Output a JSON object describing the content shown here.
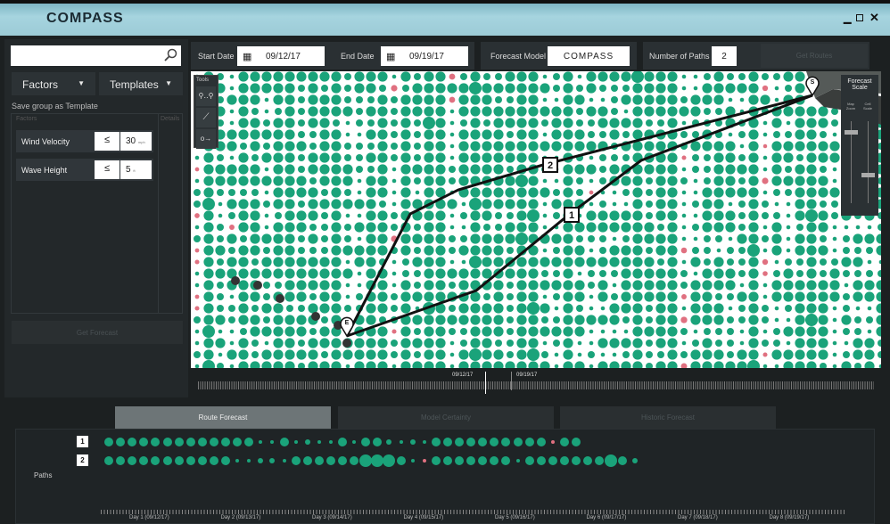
{
  "app": {
    "title": "COMPASS",
    "window_controls": [
      "minimize",
      "maximize",
      "close"
    ]
  },
  "sidebar": {
    "search_value": "",
    "factors_label": "Factors",
    "templates_label": "Templates",
    "save_template": "Save group as Template",
    "col_factors": "Factors",
    "col_details": "Details",
    "factors": [
      {
        "name": "Wind Velocity",
        "op": "≤",
        "value": "30",
        "unit": "mph"
      },
      {
        "name": "Wave Height",
        "op": "≤",
        "value": "5",
        "unit": "ft"
      }
    ],
    "get_forecast": "Get Forecast"
  },
  "toolbar": {
    "start_label": "Start Date",
    "start_value": "09/12/17",
    "end_label": "End Date",
    "end_value": "09/19/17",
    "model_label": "Forecast Model",
    "model_value": "COMPASS",
    "paths_label": "Number of Paths",
    "paths_value": "2",
    "get_routes": "Get Routes"
  },
  "map": {
    "tools_label": "Tools",
    "tools": [
      "waypoints-tool",
      "line-tool",
      "route-tool"
    ],
    "scale_title": "Forecast Scale",
    "scale_map_zoom": "Map Zoom",
    "scale_cell": "Cell Scale",
    "start_marker": "S",
    "end_marker": "E",
    "route_labels": [
      "1",
      "2"
    ],
    "colors": {
      "good": "#1aa37a",
      "bad": "#e07080"
    }
  },
  "timeline": {
    "start": "09/12/17",
    "end": "09/19/17"
  },
  "tabs": [
    {
      "label": "Route Forecast",
      "active": true
    },
    {
      "label": "Model Certainty",
      "active": false
    },
    {
      "label": "Historic Forecast",
      "active": false
    }
  ],
  "paths": {
    "label": "Paths",
    "rows": [
      {
        "id": "1",
        "levels": [
          3,
          3,
          3,
          3,
          3,
          3,
          3,
          3,
          3,
          3,
          3,
          3,
          3,
          1,
          1,
          3,
          1,
          2,
          1,
          1,
          3,
          1,
          3,
          3,
          2,
          1,
          2,
          1,
          3,
          3,
          3,
          3,
          3,
          3,
          3,
          3,
          3,
          3,
          "r",
          3,
          3
        ]
      },
      {
        "id": "2",
        "levels": [
          3,
          3,
          3,
          3,
          3,
          3,
          3,
          3,
          3,
          3,
          3,
          1,
          1,
          2,
          2,
          1,
          3,
          3,
          3,
          3,
          3,
          3,
          4,
          4,
          4,
          3,
          1,
          "r",
          3,
          3,
          3,
          3,
          3,
          3,
          3,
          1,
          3,
          3,
          3,
          3,
          3,
          3,
          3,
          4,
          3,
          2
        ]
      }
    ],
    "days": [
      "Day 1 (09/12/17)",
      "Day 2 (09/13/17)",
      "Day 3 (09/14/17)",
      "Day 4 (09/15/17)",
      "Day 5 (09/16/17)",
      "Day 6 (09/17/17)",
      "Day 7 (09/18/17)",
      "Day 8 (09/19/17)"
    ]
  }
}
